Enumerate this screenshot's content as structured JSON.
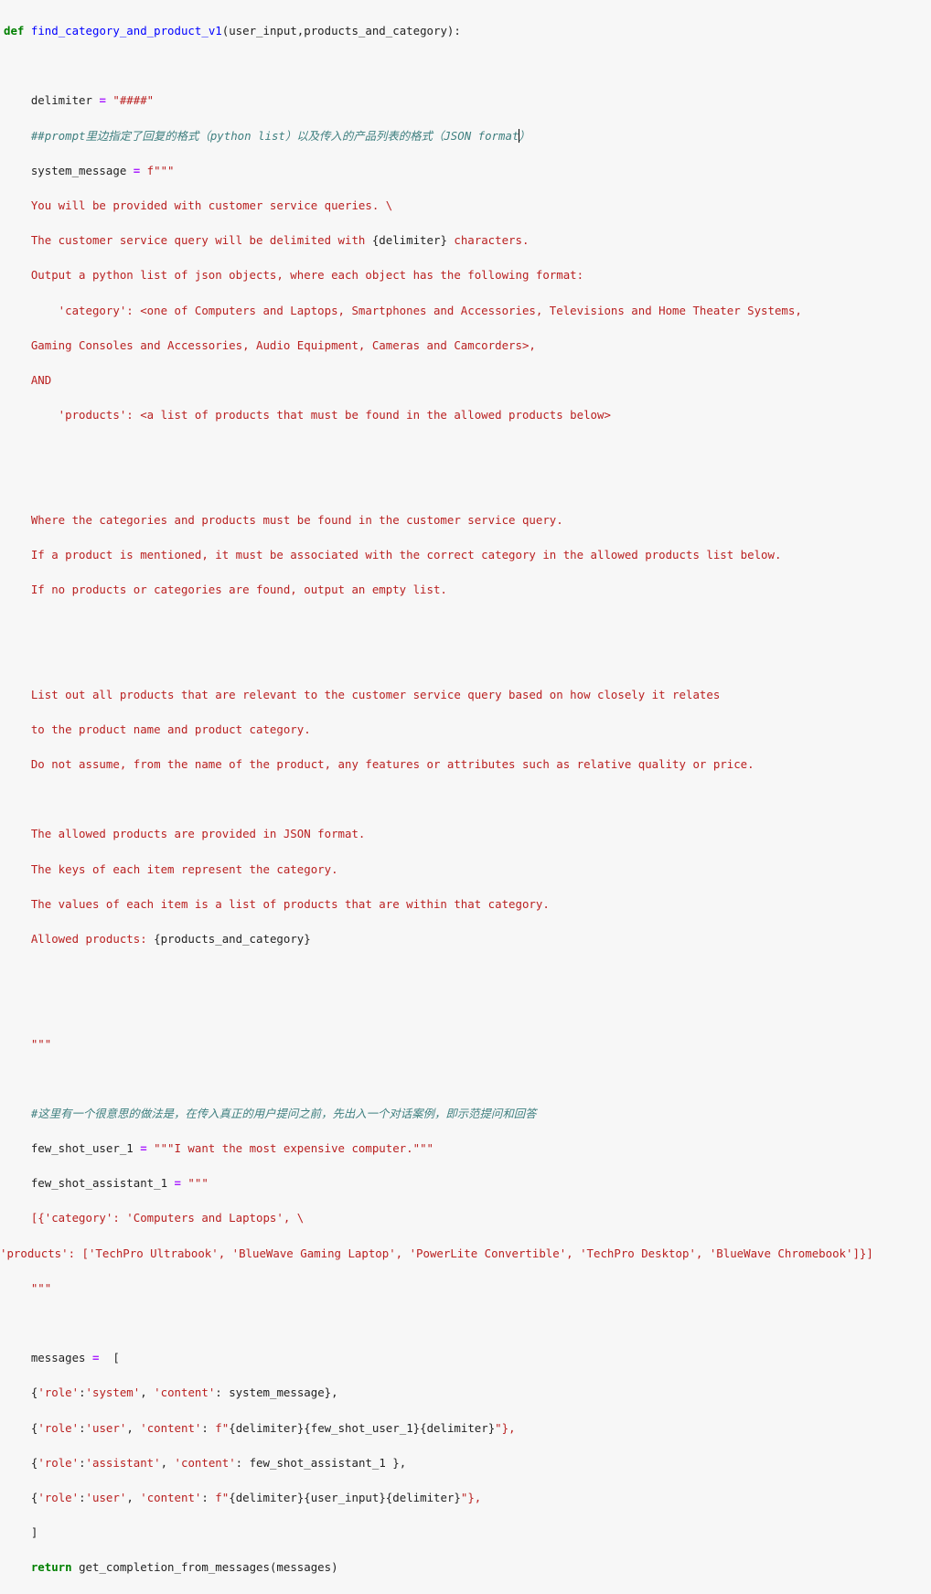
{
  "cell": {
    "def_keyword": "def",
    "function_name": "find_category_and_product_v1",
    "params": "(user_input,products_and_category):",
    "delimiter_var": "    delimiter ",
    "eq": "=",
    "delimiter_value": " \"####\"",
    "comment_1": "    ##prompt里边指定了回复的格式（python list）以及传入的产品列表的格式（JSON format",
    "comment_1_tail": "）",
    "system_message_var": "    system_message ",
    "fstring_open": " f\"\"\"",
    "prompt_lines": [
      "    You will be provided with customer service queries. \\",
      "    The customer service query will be delimited with ",
      "    Output a python list of json objects, where each object has the following format:",
      "        'category': <one of Computers and Laptops, Smartphones and Accessories, Televisions and Home Theater Systems,",
      "    Gaming Consoles and Accessories, Audio Equipment, Cameras and Camcorders>,",
      "    AND",
      "        'products': <a list of products that must be found in the allowed products below>",
      "    Where the categories and products must be found in the customer service query.",
      "    If a product is mentioned, it must be associated with the correct category in the allowed products list below.",
      "    If no products or categories are found, output an empty list.",
      "    List out all products that are relevant to the customer service query based on how closely it relates",
      "    to the product name and product category.",
      "    Do not assume, from the name of the product, any features or attributes such as relative quality or price.",
      "    The allowed products are provided in JSON format.",
      "    The keys of each item represent the category.",
      "    The values of each item is a list of products that are within that category.",
      "    Allowed products: "
    ],
    "delimiter_interp": "{delimiter}",
    "characters_suffix": " characters.",
    "products_interp": "{products_and_category}",
    "triple_quote_close": "    \"\"\"",
    "comment_2": "    #这里有一个很意思的做法是，在传入真正的用户提问之前，先出入一个对话案例，即示范提问和回答",
    "few_shot_user_var": "    few_shot_user_1 ",
    "few_shot_user_value": " \"\"\"I want the most expensive computer.\"\"\"",
    "few_shot_assistant_var": "    few_shot_assistant_1 ",
    "few_shot_assistant_open": " \"\"\"",
    "few_shot_assistant_line1": "    [{'category': 'Computers and Laptops', \\",
    "few_shot_assistant_line2": "'products': ['TechPro Ultrabook', 'BlueWave Gaming Laptop', 'PowerLite Convertible', 'TechPro Desktop', 'BlueWave Chromebook']}]",
    "few_shot_assistant_close": "    \"\"\"",
    "messages_var": "    messages ",
    "messages_open": "  [",
    "msg_lines": [
      {
        "role_key": "'role'",
        "role_val": "'system'",
        "content_key": "'content'",
        "content_val": " system_message},"
      },
      {
        "role_key": "'role'",
        "role_val": "'user'",
        "content_key": "'content'",
        "fprefix": " f\"",
        "content_val": "{delimiter}{few_shot_user_1}{delimiter}",
        "fsuffix": "\"},"
      },
      {
        "role_key": "'role'",
        "role_val": "'assistant'",
        "content_key": "'content'",
        "content_val": " few_shot_assistant_1 },"
      },
      {
        "role_key": "'role'",
        "role_val": "'user'",
        "content_key": "'content'",
        "fprefix": " f\"",
        "content_val": "{delimiter}{user_input}{delimiter}",
        "fsuffix": "\"},"
      }
    ],
    "messages_close": "    ]",
    "return_keyword": "return",
    "return_expr": " get_completion_from_messages(messages)"
  }
}
